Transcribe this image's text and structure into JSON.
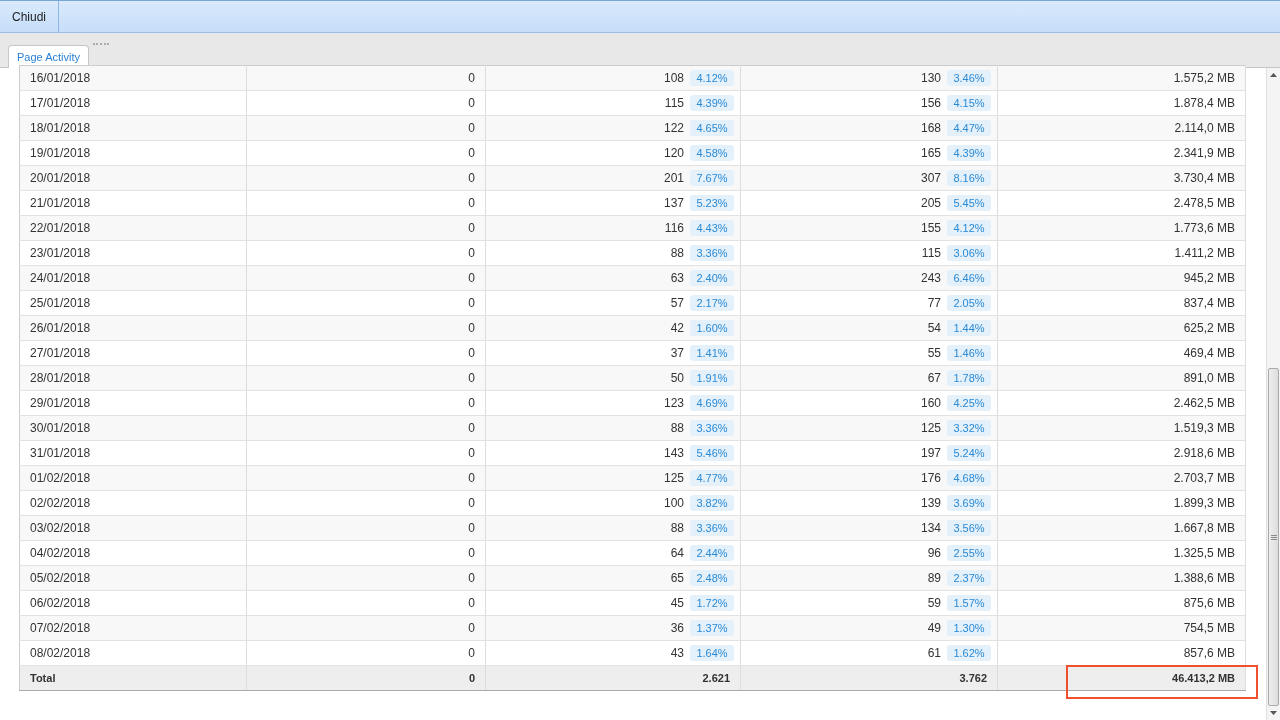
{
  "toolbar": {
    "buttons": [
      "Chiudi"
    ]
  },
  "tabs": [
    {
      "label": "Page Activity",
      "selected": true
    }
  ],
  "table": {
    "rows": [
      {
        "date": "16/01/2018",
        "column_2": "0",
        "column_3": "108",
        "column_3_pct": "4.12%",
        "column_4": "130",
        "column_4_pct": "3.46%",
        "column_5": "1.575,2 MB"
      },
      {
        "date": "17/01/2018",
        "column_2": "0",
        "column_3": "115",
        "column_3_pct": "4.39%",
        "column_4": "156",
        "column_4_pct": "4.15%",
        "column_5": "1.878,4 MB"
      },
      {
        "date": "18/01/2018",
        "column_2": "0",
        "column_3": "122",
        "column_3_pct": "4.65%",
        "column_4": "168",
        "column_4_pct": "4.47%",
        "column_5": "2.114,0 MB"
      },
      {
        "date": "19/01/2018",
        "column_2": "0",
        "column_3": "120",
        "column_3_pct": "4.58%",
        "column_4": "165",
        "column_4_pct": "4.39%",
        "column_5": "2.341,9 MB"
      },
      {
        "date": "20/01/2018",
        "column_2": "0",
        "column_3": "201",
        "column_3_pct": "7.67%",
        "column_4": "307",
        "column_4_pct": "8.16%",
        "column_5": "3.730,4 MB"
      },
      {
        "date": "21/01/2018",
        "column_2": "0",
        "column_3": "137",
        "column_3_pct": "5.23%",
        "column_4": "205",
        "column_4_pct": "5.45%",
        "column_5": "2.478,5 MB"
      },
      {
        "date": "22/01/2018",
        "column_2": "0",
        "column_3": "116",
        "column_3_pct": "4.43%",
        "column_4": "155",
        "column_4_pct": "4.12%",
        "column_5": "1.773,6 MB"
      },
      {
        "date": "23/01/2018",
        "column_2": "0",
        "column_3": "88",
        "column_3_pct": "3.36%",
        "column_4": "115",
        "column_4_pct": "3.06%",
        "column_5": "1.411,2 MB"
      },
      {
        "date": "24/01/2018",
        "column_2": "0",
        "column_3": "63",
        "column_3_pct": "2.40%",
        "column_4": "243",
        "column_4_pct": "6.46%",
        "column_5": "945,2 MB"
      },
      {
        "date": "25/01/2018",
        "column_2": "0",
        "column_3": "57",
        "column_3_pct": "2.17%",
        "column_4": "77",
        "column_4_pct": "2.05%",
        "column_5": "837,4 MB"
      },
      {
        "date": "26/01/2018",
        "column_2": "0",
        "column_3": "42",
        "column_3_pct": "1.60%",
        "column_4": "54",
        "column_4_pct": "1.44%",
        "column_5": "625,2 MB"
      },
      {
        "date": "27/01/2018",
        "column_2": "0",
        "column_3": "37",
        "column_3_pct": "1.41%",
        "column_4": "55",
        "column_4_pct": "1.46%",
        "column_5": "469,4 MB"
      },
      {
        "date": "28/01/2018",
        "column_2": "0",
        "column_3": "50",
        "column_3_pct": "1.91%",
        "column_4": "67",
        "column_4_pct": "1.78%",
        "column_5": "891,0 MB"
      },
      {
        "date": "29/01/2018",
        "column_2": "0",
        "column_3": "123",
        "column_3_pct": "4.69%",
        "column_4": "160",
        "column_4_pct": "4.25%",
        "column_5": "2.462,5 MB"
      },
      {
        "date": "30/01/2018",
        "column_2": "0",
        "column_3": "88",
        "column_3_pct": "3.36%",
        "column_4": "125",
        "column_4_pct": "3.32%",
        "column_5": "1.519,3 MB"
      },
      {
        "date": "31/01/2018",
        "column_2": "0",
        "column_3": "143",
        "column_3_pct": "5.46%",
        "column_4": "197",
        "column_4_pct": "5.24%",
        "column_5": "2.918,6 MB"
      },
      {
        "date": "01/02/2018",
        "column_2": "0",
        "column_3": "125",
        "column_3_pct": "4.77%",
        "column_4": "176",
        "column_4_pct": "4.68%",
        "column_5": "2.703,7 MB"
      },
      {
        "date": "02/02/2018",
        "column_2": "0",
        "column_3": "100",
        "column_3_pct": "3.82%",
        "column_4": "139",
        "column_4_pct": "3.69%",
        "column_5": "1.899,3 MB"
      },
      {
        "date": "03/02/2018",
        "column_2": "0",
        "column_3": "88",
        "column_3_pct": "3.36%",
        "column_4": "134",
        "column_4_pct": "3.56%",
        "column_5": "1.667,8 MB"
      },
      {
        "date": "04/02/2018",
        "column_2": "0",
        "column_3": "64",
        "column_3_pct": "2.44%",
        "column_4": "96",
        "column_4_pct": "2.55%",
        "column_5": "1.325,5 MB"
      },
      {
        "date": "05/02/2018",
        "column_2": "0",
        "column_3": "65",
        "column_3_pct": "2.48%",
        "column_4": "89",
        "column_4_pct": "2.37%",
        "column_5": "1.388,6 MB"
      },
      {
        "date": "06/02/2018",
        "column_2": "0",
        "column_3": "45",
        "column_3_pct": "1.72%",
        "column_4": "59",
        "column_4_pct": "1.57%",
        "column_5": "875,6 MB"
      },
      {
        "date": "07/02/2018",
        "column_2": "0",
        "column_3": "36",
        "column_3_pct": "1.37%",
        "column_4": "49",
        "column_4_pct": "1.30%",
        "column_5": "754,5 MB"
      },
      {
        "date": "08/02/2018",
        "column_2": "0",
        "column_3": "43",
        "column_3_pct": "1.64%",
        "column_4": "61",
        "column_4_pct": "1.62%",
        "column_5": "857,6 MB"
      }
    ],
    "total": {
      "label": "Total",
      "column_2": "0",
      "column_3": "2.621",
      "column_4": "3.762",
      "column_5": "46.413,2 MB",
      "highlighted": true
    }
  }
}
